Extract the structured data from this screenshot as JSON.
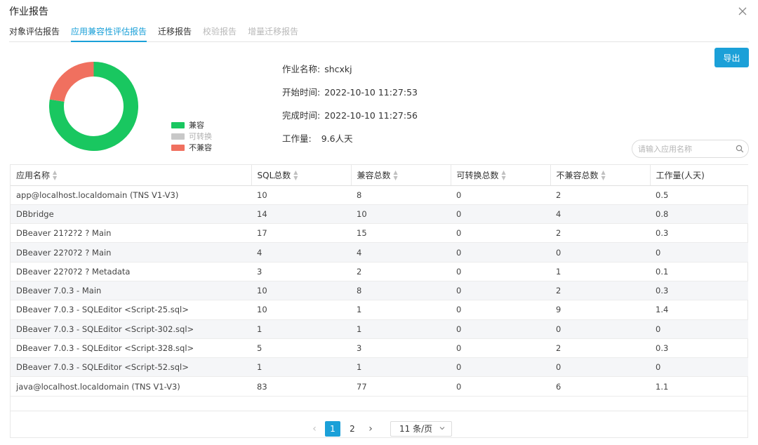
{
  "dialog": {
    "title": "作业报告"
  },
  "tabs": [
    {
      "label": "对象评估报告",
      "state": "normal"
    },
    {
      "label": "应用兼容性评估报告",
      "state": "active"
    },
    {
      "label": "迁移报告",
      "state": "normal"
    },
    {
      "label": "校验报告",
      "state": "disabled"
    },
    {
      "label": "增量迁移报告",
      "state": "disabled"
    }
  ],
  "summary_chart": {
    "type": "donut",
    "segments": [
      {
        "label": "兼容",
        "value": 77.5,
        "color": "#19c760"
      },
      {
        "label": "可转换",
        "value": 0,
        "color": "#c8c8c8"
      },
      {
        "label": "不兼容",
        "value": 22.5,
        "color": "#f0705f"
      }
    ]
  },
  "job": {
    "name_label": "作业名称:",
    "name_value": "shcxkj",
    "start_label": "开始时间:",
    "start_value": "2022-10-10 11:27:53",
    "end_label": "完成时间:",
    "end_value": "2022-10-10 11:27:56",
    "workload_label": "工作量:",
    "workload_value": "9.6人天"
  },
  "toolbar": {
    "export_label": "导出"
  },
  "search": {
    "placeholder": "请输入应用名称",
    "value": ""
  },
  "table": {
    "columns": [
      {
        "label": "应用名称",
        "sortable": true
      },
      {
        "label": "SQL总数",
        "sortable": true
      },
      {
        "label": "兼容总数",
        "sortable": true
      },
      {
        "label": "可转换总数",
        "sortable": true
      },
      {
        "label": "不兼容总数",
        "sortable": true
      },
      {
        "label": "工作量(人天)",
        "sortable": false
      }
    ],
    "rows": [
      [
        "app@localhost.localdomain (TNS V1-V3)",
        "10",
        "8",
        "0",
        "2",
        "0.5"
      ],
      [
        "DBbridge",
        "14",
        "10",
        "0",
        "4",
        "0.8"
      ],
      [
        "DBeaver 21?2?2 ? Main",
        "17",
        "15",
        "0",
        "2",
        "0.3"
      ],
      [
        "DBeaver 22?0?2 ? Main",
        "4",
        "4",
        "0",
        "0",
        "0"
      ],
      [
        "DBeaver 22?0?2 ? Metadata",
        "3",
        "2",
        "0",
        "1",
        "0.1"
      ],
      [
        "DBeaver 7.0.3 - Main",
        "10",
        "8",
        "0",
        "2",
        "0.3"
      ],
      [
        "DBeaver 7.0.3 - SQLEditor <Script-25.sql>",
        "10",
        "1",
        "0",
        "9",
        "1.4"
      ],
      [
        "DBeaver 7.0.3 - SQLEditor <Script-302.sql>",
        "1",
        "1",
        "0",
        "0",
        "0"
      ],
      [
        "DBeaver 7.0.3 - SQLEditor <Script-328.sql>",
        "5",
        "3",
        "0",
        "2",
        "0.3"
      ],
      [
        "DBeaver 7.0.3 - SQLEditor <Script-52.sql>",
        "1",
        "1",
        "0",
        "0",
        "0"
      ],
      [
        "java@localhost.localdomain (TNS V1-V3)",
        "83",
        "77",
        "0",
        "6",
        "1.1"
      ]
    ]
  },
  "pagination": {
    "pages": [
      "1",
      "2"
    ],
    "current": "1",
    "page_size_label": "11 条/页"
  }
}
